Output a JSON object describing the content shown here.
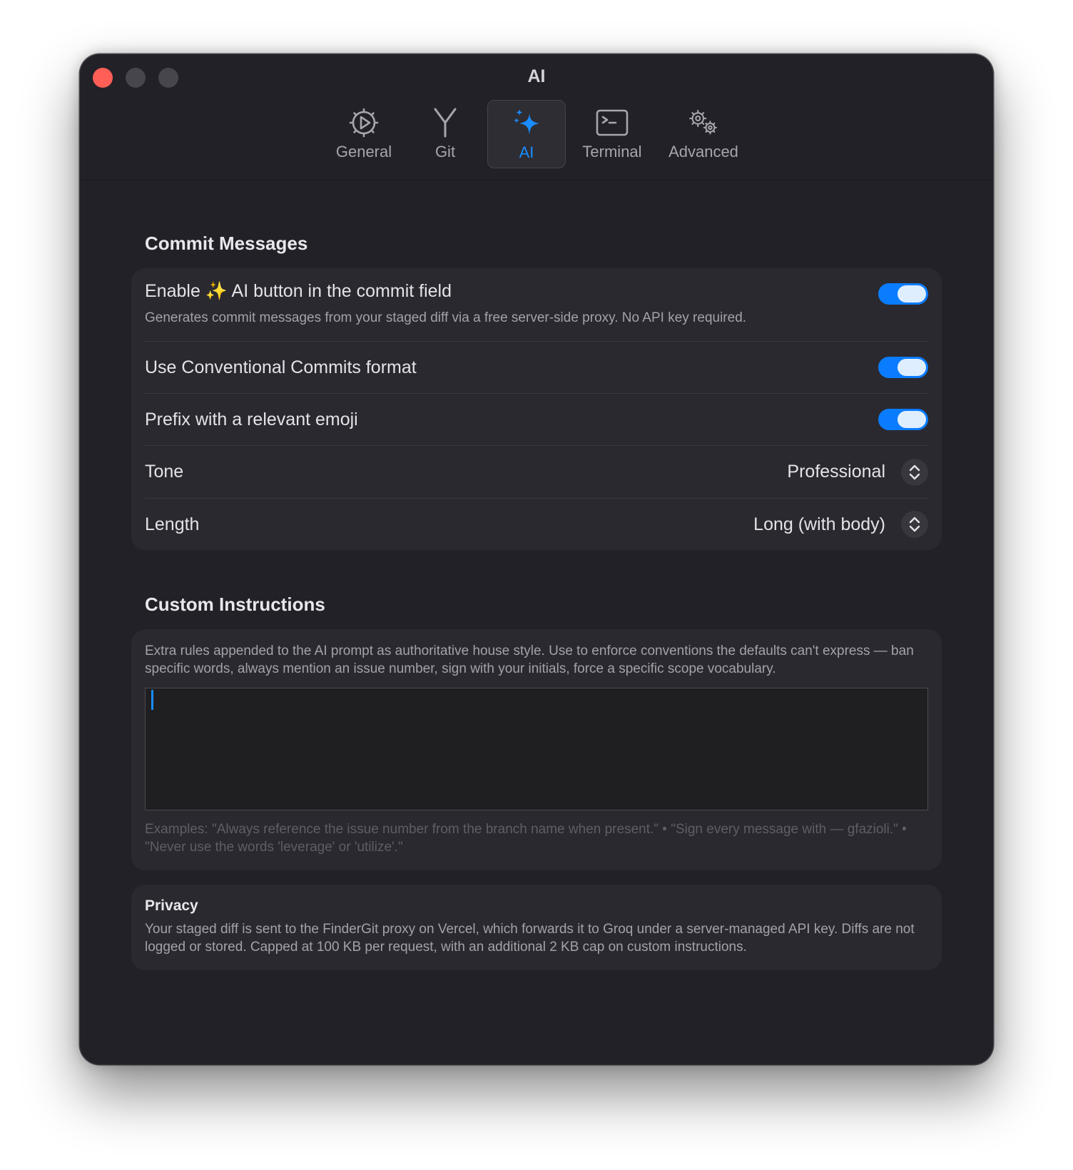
{
  "window": {
    "title": "AI"
  },
  "tabs": [
    {
      "label": "General",
      "icon": "gear-play-icon"
    },
    {
      "label": "Git",
      "icon": "branch-icon"
    },
    {
      "label": "AI",
      "icon": "sparkles-icon",
      "active": true
    },
    {
      "label": "Terminal",
      "icon": "terminal-icon"
    },
    {
      "label": "Advanced",
      "icon": "gears-icon"
    }
  ],
  "commit_messages": {
    "title": "Commit Messages",
    "enable_ai": {
      "label_prefix": "Enable",
      "label_emoji": "✨",
      "label_suffix": "AI button in the commit field",
      "description": "Generates commit messages from your staged diff via a free server-side proxy. No API key required.",
      "enabled": true
    },
    "conventional": {
      "label": "Use Conventional Commits format",
      "enabled": true
    },
    "emoji_prefix": {
      "label": "Prefix with a relevant emoji",
      "enabled": true
    },
    "tone": {
      "label": "Tone",
      "value": "Professional"
    },
    "length": {
      "label": "Length",
      "value": "Long (with body)"
    }
  },
  "custom_instructions": {
    "title": "Custom Instructions",
    "help": "Extra rules appended to the AI prompt as authoritative house style. Use to enforce conventions the defaults can't express — ban specific words, always mention an issue number, sign with your initials, force a specific scope vocabulary.",
    "value": "",
    "examples": "Examples: \"Always reference the issue number from the branch name when present.\" • \"Sign every message with — gfazioli.\" • \"Never use the words 'leverage' or 'utilize'.\""
  },
  "privacy": {
    "title": "Privacy",
    "text": "Your staged diff is sent to the FinderGit proxy on Vercel, which forwards it to Groq under a server-managed API key. Diffs are not logged or stored. Capped at 100 KB per request, with an additional 2 KB cap on custom instructions."
  },
  "colors": {
    "accent": "#0a7cff",
    "window_bg": "#222127",
    "card_bg": "#2a292f",
    "close": "#ff5f57"
  }
}
